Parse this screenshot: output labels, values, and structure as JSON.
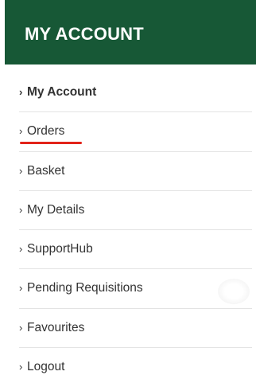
{
  "header": {
    "title": "MY ACCOUNT"
  },
  "menu": {
    "chevron": "›",
    "items": [
      {
        "label": "My Account"
      },
      {
        "label": "Orders"
      },
      {
        "label": "Basket"
      },
      {
        "label": "My Details"
      },
      {
        "label": "SupportHub"
      },
      {
        "label": "Pending Requisitions"
      },
      {
        "label": "Favourites"
      },
      {
        "label": "Logout"
      }
    ]
  },
  "colors": {
    "header_bg": "#175836",
    "header_text": "#ffffff",
    "menu_text": "#333333",
    "divider": "#e3e3e3",
    "annotation_underline": "#e2231a"
  }
}
